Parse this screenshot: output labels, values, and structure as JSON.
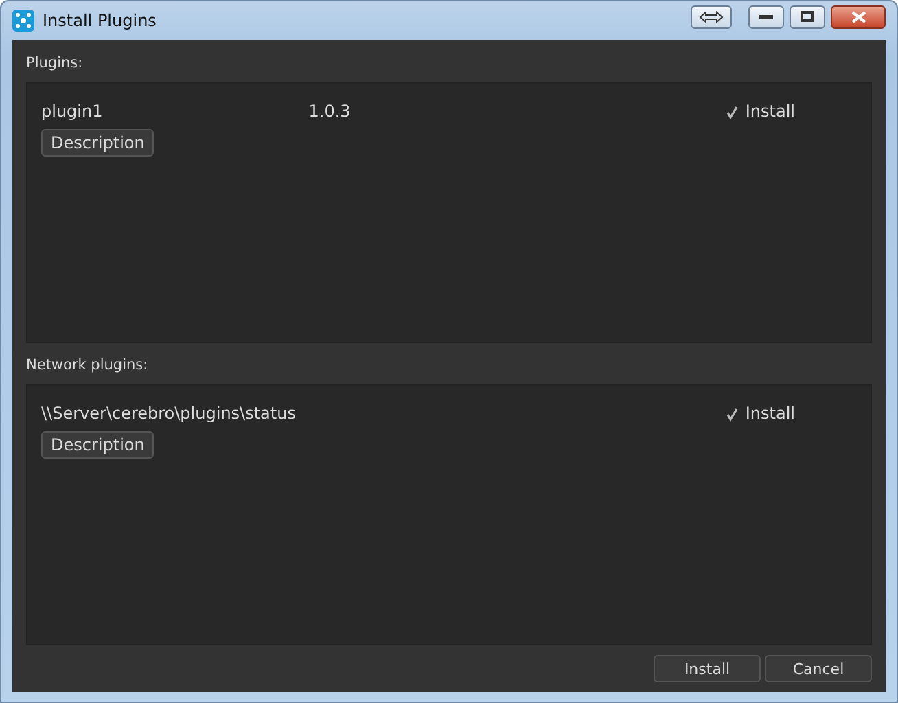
{
  "window": {
    "title": "Install Plugins"
  },
  "sections": [
    {
      "label": "Plugins:",
      "plugins": [
        {
          "name": "plugin1",
          "version": "1.0.3",
          "install_label": "Install",
          "checked": true,
          "description_button": "Description"
        }
      ]
    },
    {
      "label": "Network plugins:",
      "plugins": [
        {
          "name": "\\\\Server\\cerebro\\plugins\\status",
          "install_label": "Install",
          "checked": true,
          "description_button": "Description"
        }
      ]
    }
  ],
  "buttons": [
    "Install",
    "Cancel"
  ]
}
